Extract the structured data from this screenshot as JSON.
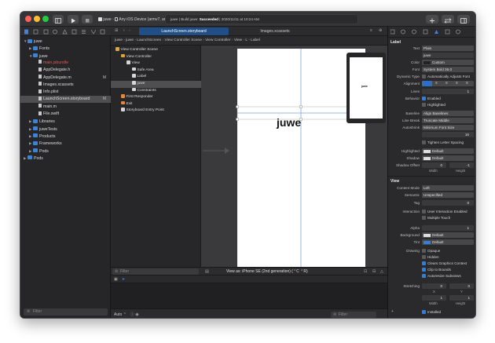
{
  "toolbar": {
    "scheme": "juwe",
    "device": "Any iOS Device (armv7, arm64)",
    "status_project": "juwe | Build juwe: ",
    "status_result": "Succeeded",
    "status_time": " | 2020/11/11 at 10:24 AM",
    "colors": {
      "close": "#ff5f57",
      "minimize": "#febc2e",
      "zoom": "#28c840"
    }
  },
  "navigator": {
    "items": [
      {
        "label": "juwe",
        "kind": "project",
        "indent": 0,
        "open": true
      },
      {
        "label": "Fonts",
        "kind": "folder",
        "indent": 1,
        "open": false
      },
      {
        "label": "juwe",
        "kind": "folder",
        "indent": 1,
        "open": true
      },
      {
        "label": "main.jsbundle",
        "kind": "file-missing",
        "indent": 2
      },
      {
        "label": "AppDelegate.h",
        "kind": "file",
        "indent": 2
      },
      {
        "label": "AppDelegate.m",
        "kind": "file",
        "indent": 2,
        "badge": "M"
      },
      {
        "label": "Images.xcassets",
        "kind": "file",
        "indent": 2
      },
      {
        "label": "Info.plist",
        "kind": "file",
        "indent": 2
      },
      {
        "label": "LaunchScreen.storyboard",
        "kind": "file",
        "indent": 2,
        "badge": "M",
        "selected": true
      },
      {
        "label": "main.m",
        "kind": "file",
        "indent": 2
      },
      {
        "label": "File.swift",
        "kind": "file",
        "indent": 2
      },
      {
        "label": "Libraries",
        "kind": "folder",
        "indent": 1,
        "open": false
      },
      {
        "label": "juweTests",
        "kind": "folder",
        "indent": 1,
        "open": false
      },
      {
        "label": "Products",
        "kind": "folder",
        "indent": 1,
        "open": false
      },
      {
        "label": "Frameworks",
        "kind": "folder",
        "indent": 1,
        "open": false
      },
      {
        "label": "Pods",
        "kind": "folder",
        "indent": 1,
        "open": false
      },
      {
        "label": "Pods",
        "kind": "project",
        "indent": 0,
        "open": false
      }
    ],
    "filter_placeholder": "Filter"
  },
  "tabs": [
    {
      "label": "LaunchScreen.storyboard",
      "active": true
    },
    {
      "label": "Images.xcassets",
      "active": false
    }
  ],
  "jumpbar": [
    "juwe",
    "juwe",
    "LaunchScreen",
    "View Controller Scene",
    "View Controller",
    "View",
    "L",
    "Label"
  ],
  "outline": {
    "items": [
      {
        "label": "View Controller Scene",
        "indent": 0
      },
      {
        "label": "View Controller",
        "indent": 1
      },
      {
        "label": "View",
        "indent": 2
      },
      {
        "label": "Safe Area",
        "indent": 3
      },
      {
        "label": "Label",
        "indent": 3
      },
      {
        "label": "juwe",
        "indent": 3,
        "selected": true
      },
      {
        "label": "Constraints",
        "indent": 3
      },
      {
        "label": "First Responder",
        "indent": 1
      },
      {
        "label": "Exit",
        "indent": 1
      },
      {
        "label": "Storyboard Entry Point",
        "indent": 1
      }
    ],
    "filter_placeholder": "Filter"
  },
  "canvas": {
    "label_text": "juwe",
    "preview_text": "juwe",
    "view_as": "View as: iPhone SE (2nd generation) (⌃C ⌃R)"
  },
  "debug": {
    "auto": "Auto ⌃",
    "filter_placeholder": "Filter"
  },
  "inspector": {
    "label_section": "Label",
    "text_label": "Text",
    "text_value": "Plain",
    "content_value": "juwe",
    "color_label": "Color",
    "color_value": "Custom",
    "font_label": "Font",
    "font_value": "System Bold 36.0",
    "dynamic_type_label": "Dynamic Type",
    "dynamic_type_value": "Automatically Adjusts Font",
    "alignment_label": "Alignment",
    "lines_label": "Lines",
    "lines_value": "1",
    "behavior_label": "Behavior",
    "enabled": "Enabled",
    "highlighted": "Highlighted",
    "baseline_label": "Baseline",
    "baseline_value": "Align Baselines",
    "line_break_label": "Line Break",
    "line_break_value": "Truncate Middle",
    "autoshrink_label": "Autoshrink",
    "autoshrink_value": "Minimum Font Size",
    "min_font_value": "16",
    "tighten": "Tighten Letter Spacing",
    "highlighted_label": "Highlighted",
    "highlighted_value": "Default",
    "shadow_label": "Shadow",
    "shadow_value": "Default",
    "shadow_offset_label": "Shadow Offset",
    "shadow_w": "0",
    "shadow_h": "-1",
    "width_label": "Width",
    "height_label": "Height",
    "view_section": "View",
    "content_mode_label": "Content Mode",
    "content_mode_value": "Left",
    "semantic_label": "Semantic",
    "semantic_value": "Unspecified",
    "tag_label": "Tag",
    "tag_value": "0",
    "interaction_label": "Interaction",
    "user_interaction": "User Interaction Enabled",
    "multiple_touch": "Multiple Touch",
    "alpha_label": "Alpha",
    "alpha_value": "1",
    "background_label": "Background",
    "background_value": "Default",
    "tint_label": "Tint",
    "tint_value": "Default",
    "drawing_label": "Drawing",
    "opaque": "Opaque",
    "hidden": "Hidden",
    "clears_graphics": "Clears Graphics Context",
    "clip_bounds": "Clip to Bounds",
    "autoresize": "Autoresize Subviews",
    "stretching_label": "Stretching",
    "x_label": "X",
    "y_label": "Y",
    "stretch_x": "0",
    "stretch_y": "0",
    "stretch_w": "1",
    "stretch_h": "1",
    "installed": "Installed"
  }
}
